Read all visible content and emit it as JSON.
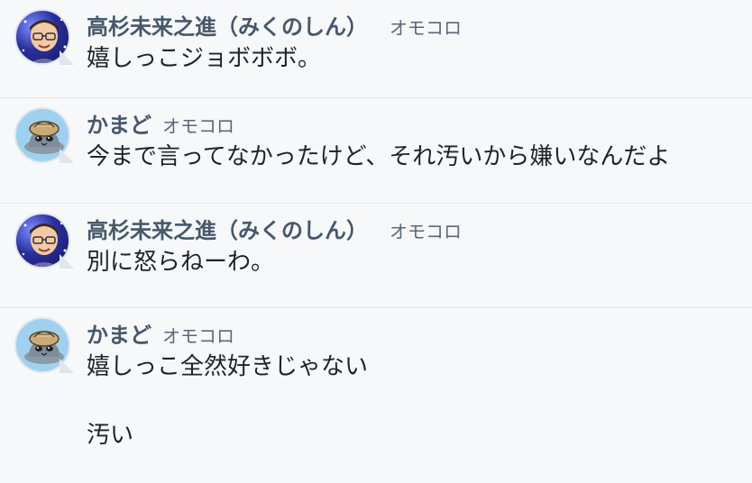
{
  "messages": [
    {
      "author": "高杉未来之進（みくのしん）",
      "tag": "オモコロ",
      "text": "嬉しっこジョボボボ。",
      "avatar": "person-with-glasses-avatar"
    },
    {
      "author": "かまど",
      "tag": "オモコロ",
      "text": "今まで言ってなかったけど、それ汚いから嫌いなんだよ",
      "avatar": "cat-with-hat-avatar"
    },
    {
      "author": "高杉未来之進（みくのしん）",
      "tag": "オモコロ",
      "text": "別に怒らねーわ。",
      "avatar": "person-with-glasses-avatar"
    },
    {
      "author": "かまど",
      "tag": "オモコロ",
      "text": "嬉しっこ全然好きじゃない\n\n汚い",
      "avatar": "cat-with-hat-avatar"
    }
  ],
  "colors": {
    "background": "#f7f8fa",
    "name": "#46586b",
    "tag": "#5a6978",
    "text": "#1f2328",
    "divider": "#e4e6ea"
  }
}
